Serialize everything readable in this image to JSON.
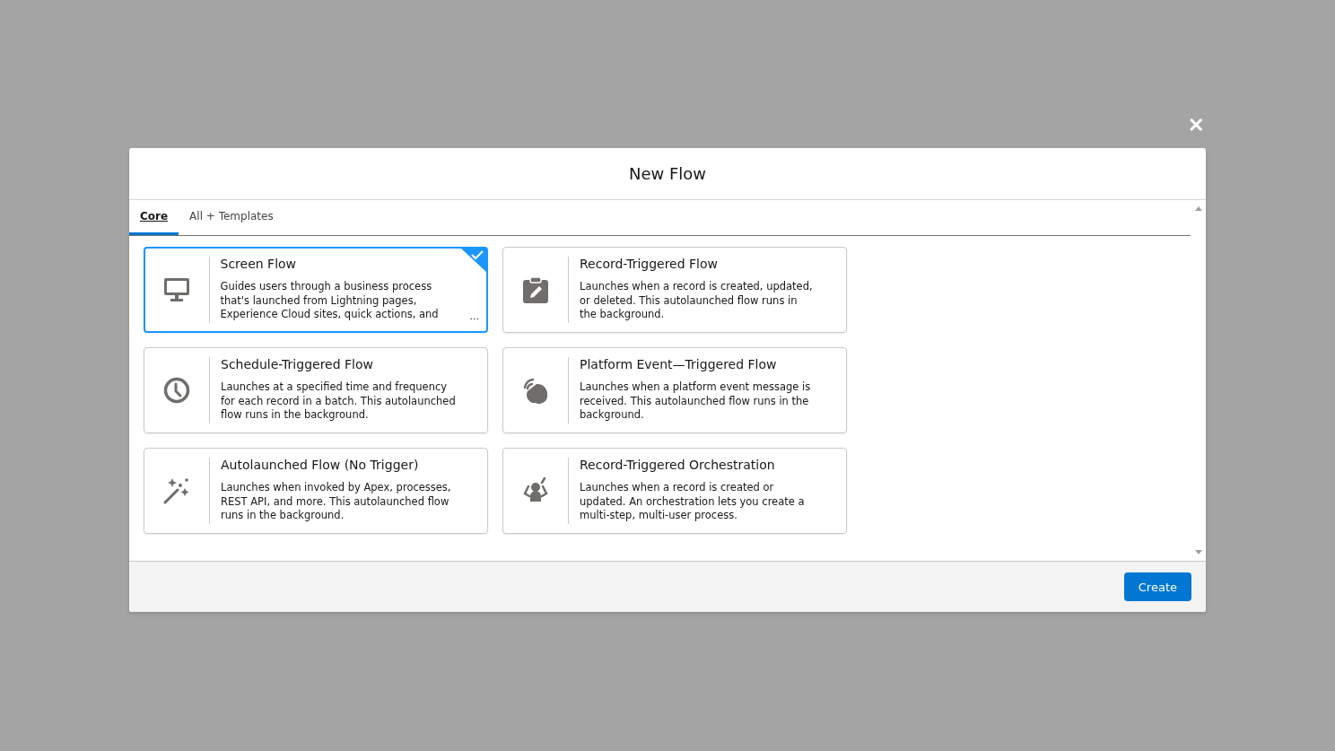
{
  "dialog": {
    "title": "New Flow",
    "close_label": "✕"
  },
  "tabs": [
    {
      "label": "Core",
      "selected": true
    },
    {
      "label": "All + Templates",
      "selected": false
    }
  ],
  "flow_types": [
    {
      "kind": "screen",
      "title": "Screen Flow",
      "description": "Guides users through a business process that's launched from Lightning pages, Experience Cloud sites, quick actions, and",
      "more": "...",
      "selected": true
    },
    {
      "kind": "record",
      "title": "Record-Triggered Flow",
      "description": "Launches when a record is created, updated, or deleted. This autolaunched flow runs in the background.",
      "selected": false
    },
    {
      "kind": "schedule",
      "title": "Schedule-Triggered Flow",
      "description": "Launches at a specified time and frequency for each record in a batch. This autolaunched flow runs in the background.",
      "selected": false
    },
    {
      "kind": "platform",
      "title": "Platform Event—Triggered Flow",
      "description": "Launches when a platform event message is received. This autolaunched flow runs in the background.",
      "selected": false
    },
    {
      "kind": "autolaunched",
      "title": "Autolaunched Flow (No Trigger)",
      "description": "Launches when invoked by Apex, processes, REST API, and more. This autolaunched flow runs in the background.",
      "selected": false
    },
    {
      "kind": "orchestration",
      "title": "Record-Triggered Orchestration",
      "description": "Launches when a record is created or updated. An orchestration lets you create a multi-step, multi-user process.",
      "selected": false
    }
  ],
  "footer": {
    "create_button": "Create"
  }
}
